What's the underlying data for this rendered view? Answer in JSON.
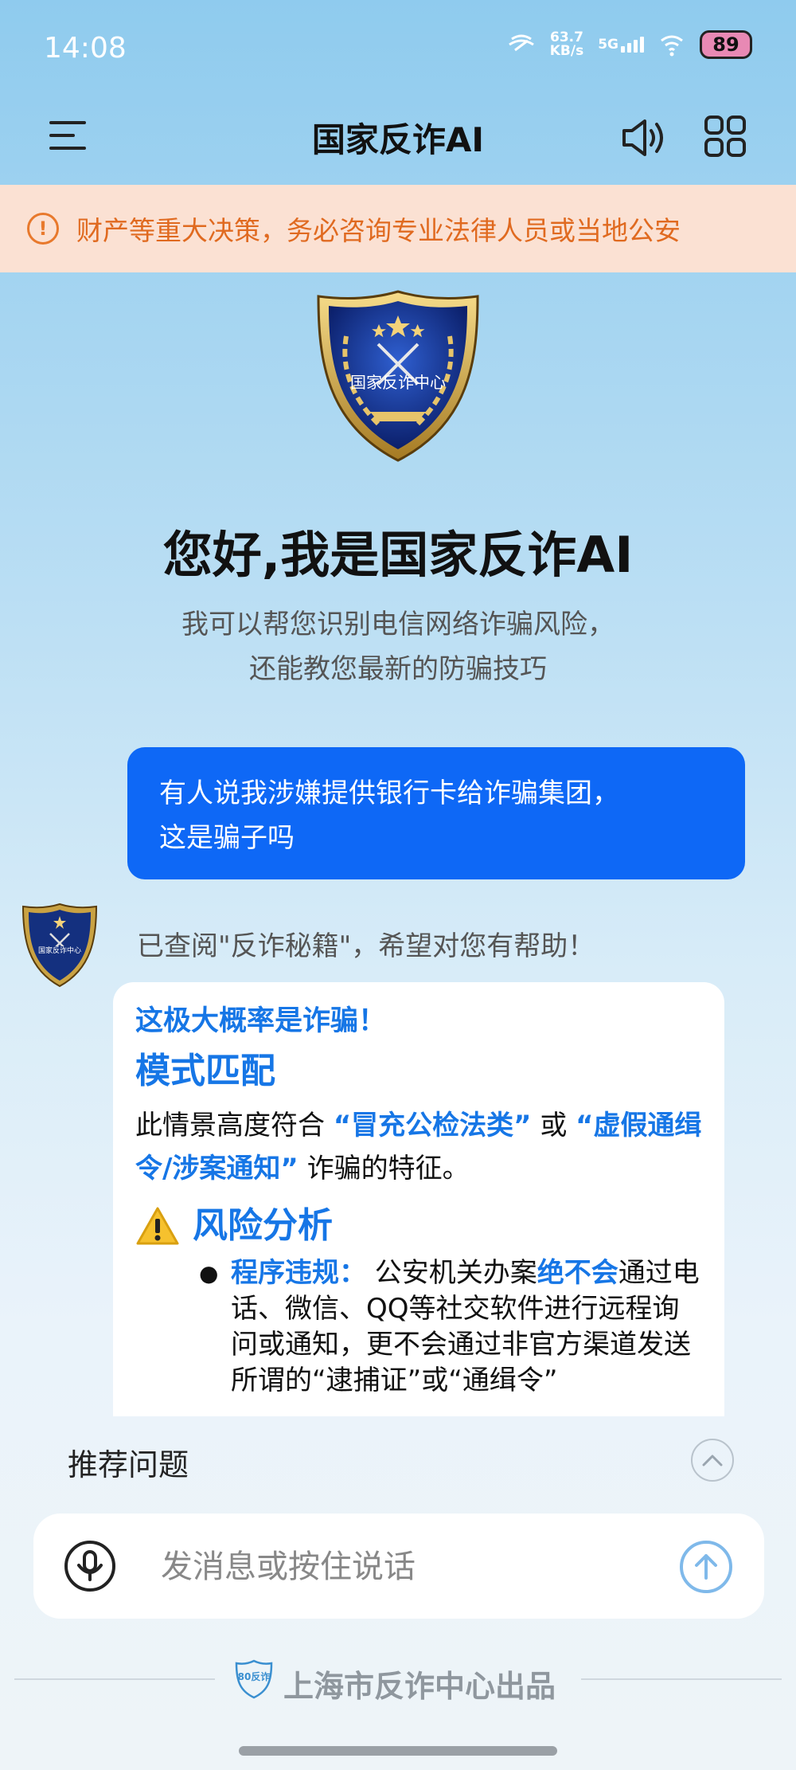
{
  "status_bar": {
    "time": "14:08",
    "net_speed_value": "63.7",
    "net_speed_unit": "KB/s",
    "network": "5G",
    "battery": "89"
  },
  "nav": {
    "title": "国家反诈AI",
    "icons": [
      "menu-icon",
      "speaker-icon",
      "grid-icon"
    ]
  },
  "banner": {
    "icon": "warning-circle-icon",
    "text": "财产等重大决策，务必咨询专业法律人员或当地公安"
  },
  "hero": {
    "emblem_text": "国家反诈中心",
    "title": "您好,我是国家反诈AI",
    "subtitle_line1": "我可以帮您识别电信网络诈骗风险，",
    "subtitle_line2": "还能教您最新的防骗技巧"
  },
  "chat": {
    "user_line1": "有人说我涉嫌提供银行卡给诈骗集团，",
    "user_line2": "这是骗子吗",
    "bot_meta": "已查阅\"反诈秘籍\"，希望对您有帮助！",
    "verdict": "这极大概率是诈骗！",
    "pattern_heading": "模式匹配",
    "pattern_pre": "此情景高度符合 ",
    "pattern_hl1": "“冒充公检法类”",
    "pattern_mid": " 或 ",
    "pattern_hl2": "“虚假通缉令/涉案通知”",
    "pattern_post": " 诈骗的特征。",
    "risk_icon": "warning-triangle-icon",
    "risk_heading": "风险分析",
    "bullet_label": "程序违规：",
    "bullet_pre": "  公安机关办案",
    "bullet_hl": "绝不会",
    "bullet_post": "通过电话、微信、QQ等社交软件进行远程询问或通知，更不会通过非官方渠道发送所谓的“逮捕证”或“通缉令”"
  },
  "recommend": {
    "label": "推荐问题",
    "toggle_icon": "chevron-up-icon"
  },
  "input": {
    "placeholder": "发消息或按住说话",
    "mic_icon": "mic-icon",
    "send_icon": "send-arrow-icon"
  },
  "footer": {
    "logo_text": "80反诈",
    "text": "上海市反诈中心出品"
  },
  "colors": {
    "accent": "#0e68f6",
    "highlight": "#1676e6",
    "warning": "#e06a20",
    "banner_bg": "#fbe1d3"
  }
}
